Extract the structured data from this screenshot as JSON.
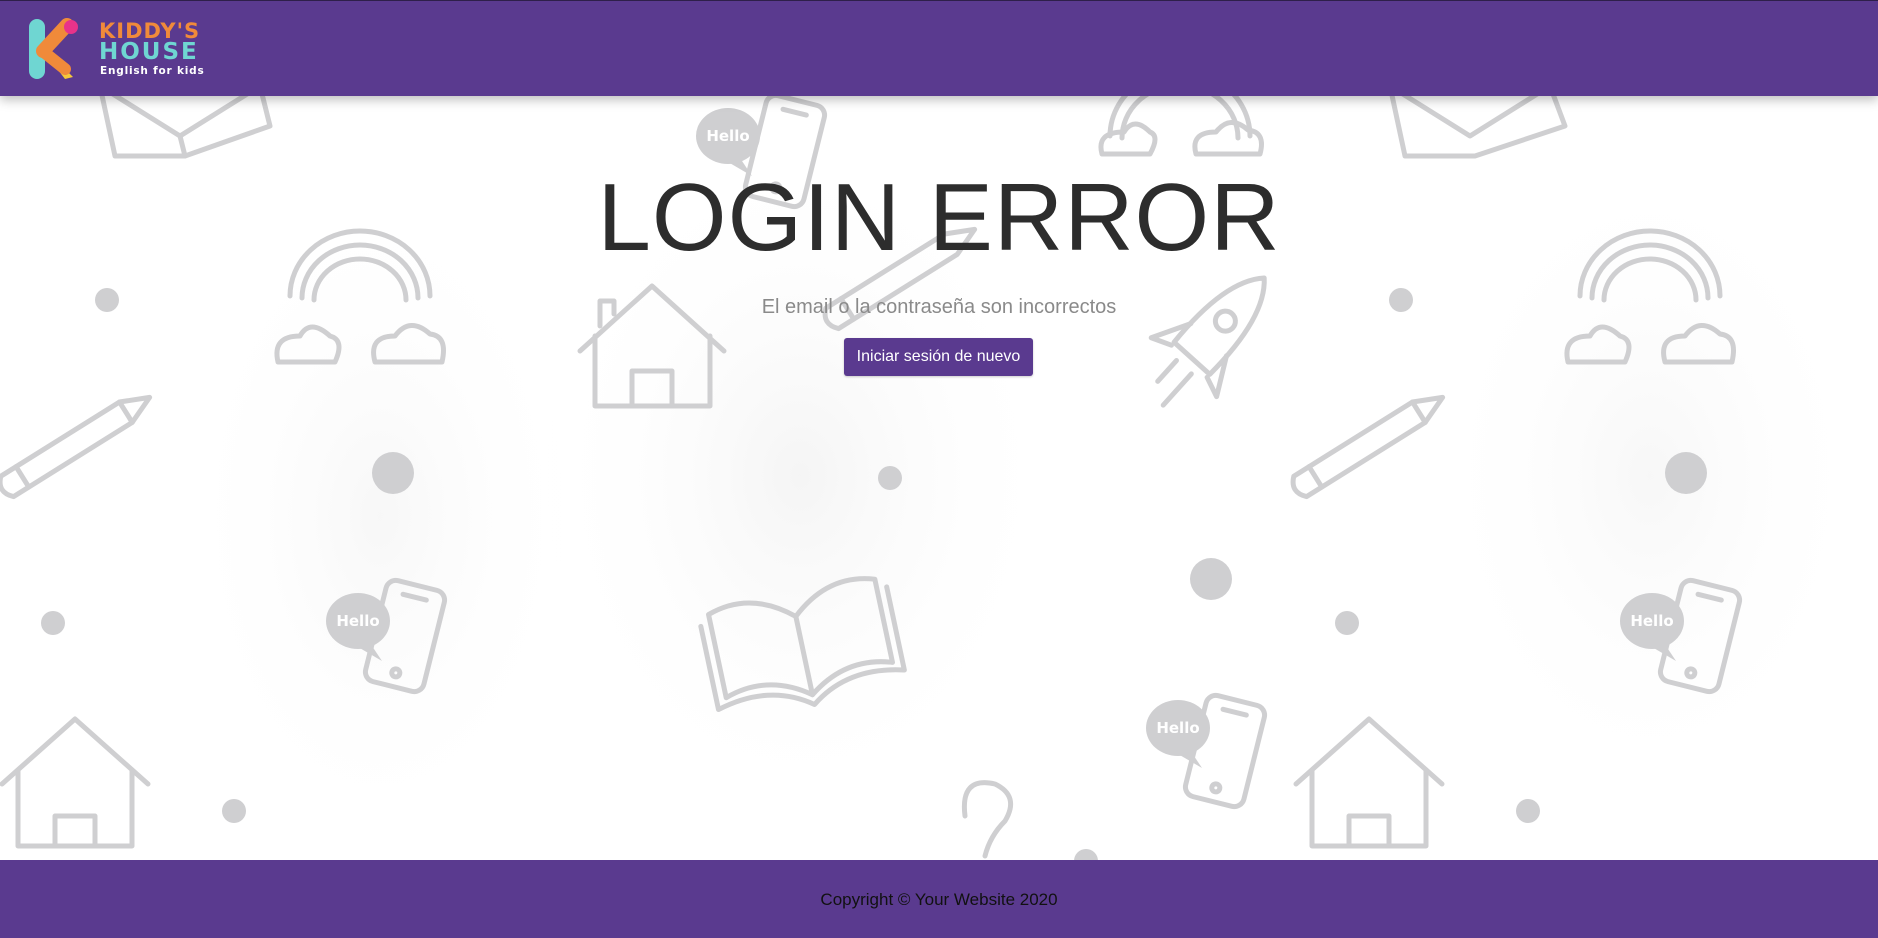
{
  "brand": {
    "name_line1": "KIDDY'S",
    "name_line2": "HOUSE",
    "tagline": "English for kids"
  },
  "main": {
    "title": "LOGIN ERROR",
    "message": "El email o la contraseña son incorrectos",
    "retry_button": "Iniciar sesión de nuevo"
  },
  "background": {
    "hello_bubble": "Hello"
  },
  "footer": {
    "copyright": "Copyright © Your Website 2020"
  },
  "colors": {
    "brand_purple": "#5a3a8f",
    "logo_orange": "#f08a3a",
    "logo_teal": "#6fd6d2",
    "logo_pink": "#e8338a",
    "doodle_gray": "#cfcfd1"
  }
}
